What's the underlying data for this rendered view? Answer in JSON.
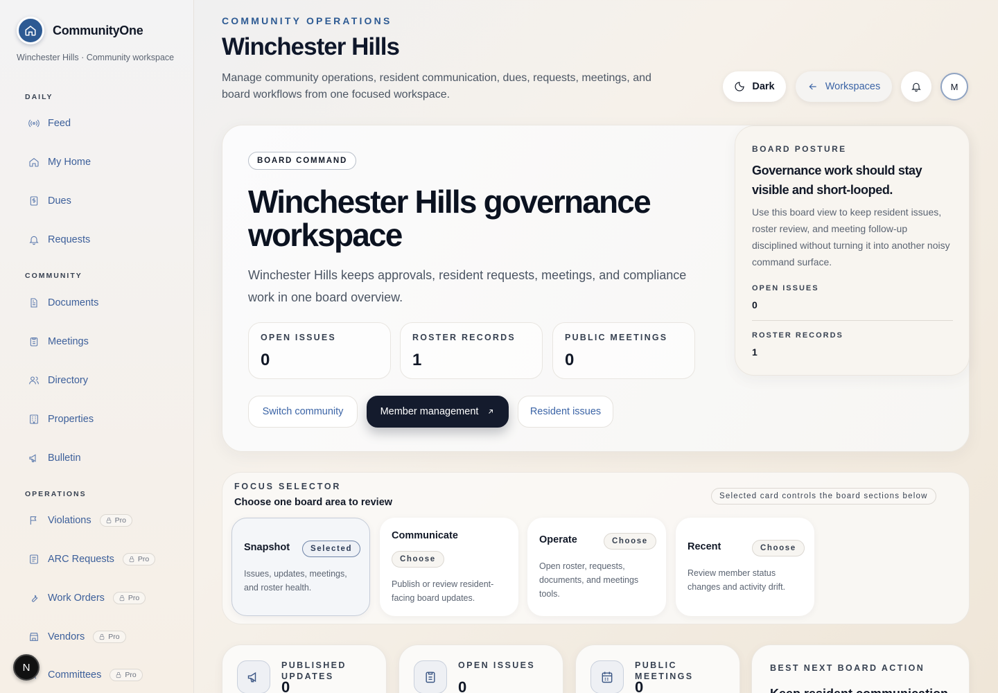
{
  "brand": {
    "name": "CommunityOne",
    "subtitle": "Winchester Hills · Community workspace"
  },
  "sidebar": {
    "sections": [
      {
        "title": "DAILY",
        "items": [
          {
            "label": "Feed",
            "icon": "broadcast-icon"
          },
          {
            "label": "My Home",
            "icon": "home-icon"
          },
          {
            "label": "Dues",
            "icon": "receipt-icon"
          },
          {
            "label": "Requests",
            "icon": "bell-icon"
          }
        ]
      },
      {
        "title": "COMMUNITY",
        "items": [
          {
            "label": "Documents",
            "icon": "document-icon"
          },
          {
            "label": "Meetings",
            "icon": "clipboard-icon"
          },
          {
            "label": "Directory",
            "icon": "users-icon"
          },
          {
            "label": "Properties",
            "icon": "building-icon"
          },
          {
            "label": "Bulletin",
            "icon": "megaphone-icon"
          }
        ]
      },
      {
        "title": "OPERATIONS",
        "items": [
          {
            "label": "Violations",
            "icon": "flag-icon",
            "badge": "Pro"
          },
          {
            "label": "ARC Requests",
            "icon": "list-icon",
            "badge": "Pro"
          },
          {
            "label": "Work Orders",
            "icon": "wrench-icon",
            "badge": "Pro"
          },
          {
            "label": "Vendors",
            "icon": "store-icon",
            "badge": "Pro"
          },
          {
            "label": "Committees",
            "icon": "users-icon",
            "badge": "Pro"
          }
        ]
      }
    ],
    "floating_badge": "N"
  },
  "header": {
    "eyebrow": "COMMUNITY OPERATIONS",
    "title": "Winchester Hills",
    "description": "Manage community operations, resident communication, dues, requests, meetings, and board workflows from one focused workspace.",
    "dark_label": "Dark",
    "workspaces_label": "Workspaces",
    "avatar_initial": "M"
  },
  "hero": {
    "chip": "BOARD COMMAND",
    "title": "Winchester Hills governance workspace",
    "description": "Winchester Hills keeps approvals, resident requests, meetings, and compliance work in one board overview.",
    "stats": [
      {
        "label": "OPEN ISSUES",
        "value": "0"
      },
      {
        "label": "ROSTER RECORDS",
        "value": "1"
      },
      {
        "label": "PUBLIC MEETINGS",
        "value": "0"
      }
    ],
    "actions": {
      "switch": "Switch community",
      "members": "Member management",
      "issues": "Resident issues"
    }
  },
  "posture": {
    "eyebrow": "BOARD POSTURE",
    "heading": "Governance work should stay visible and short-looped.",
    "body": "Use this board view to keep resident issues, roster review, and meeting follow-up disciplined without turning it into another noisy command surface.",
    "open_issues_label": "OPEN ISSUES",
    "open_issues_value": "0",
    "roster_label": "ROSTER RECORDS",
    "roster_value": "1"
  },
  "focus": {
    "eyebrow": "FOCUS SELECTOR",
    "title": "Choose one board area to review",
    "note": "Selected card controls the board sections below",
    "cards": [
      {
        "title": "Snapshot",
        "pill": "Selected",
        "desc": "Issues, updates, meetings, and roster health."
      },
      {
        "title": "Communicate",
        "pill": "Choose",
        "desc": "Publish or review resident-facing board updates."
      },
      {
        "title": "Operate",
        "pill": "Choose",
        "desc": "Open roster, requests, documents, and meetings tools."
      },
      {
        "title": "Recent",
        "pill": "Choose",
        "desc": "Review member status changes and activity drift."
      }
    ]
  },
  "metrics": [
    {
      "label": "PUBLISHED UPDATES",
      "value": "0",
      "icon": "megaphone-icon"
    },
    {
      "label": "OPEN ISSUES",
      "value": "0",
      "icon": "clipboard-icon"
    },
    {
      "label": "PUBLIC MEETINGS",
      "value": "0",
      "icon": "calendar-icon"
    }
  ],
  "best_action": {
    "label": "BEST NEXT BOARD ACTION",
    "text": "Keep resident communication"
  }
}
